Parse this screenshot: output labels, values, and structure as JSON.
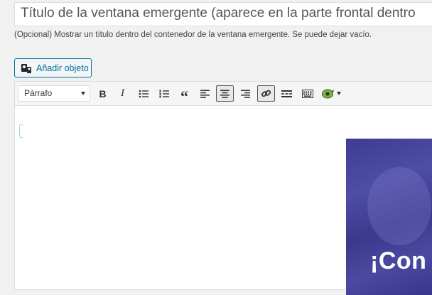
{
  "title_field": {
    "value": "Título de la ventana emergente (aparece en la parte frontal dentro"
  },
  "title_hint": "(Opcional) Mostrar un título dentro del contenedor de la ventana emergente. Se puede dejar vacío.",
  "media_button": {
    "label": "Añadir objeto",
    "icon": "add-media-icon",
    "color": "#0071a1"
  },
  "toolbar": {
    "format_select": {
      "selected": "Párrafo"
    },
    "buttons": [
      {
        "name": "bold",
        "glyph": "B"
      },
      {
        "name": "italic",
        "glyph": "I"
      },
      {
        "name": "bulleted-list"
      },
      {
        "name": "numbered-list"
      },
      {
        "name": "blockquote",
        "glyph": "“"
      },
      {
        "name": "align-left"
      },
      {
        "name": "align-center",
        "active": true
      },
      {
        "name": "align-right"
      },
      {
        "name": "insert-link",
        "active": true
      },
      {
        "name": "read-more"
      },
      {
        "name": "toolbar-toggle"
      },
      {
        "name": "plugin-shortcode"
      }
    ]
  },
  "editor": {
    "image_banner": {
      "text": "¡Con",
      "background": "#3d3c93"
    }
  }
}
